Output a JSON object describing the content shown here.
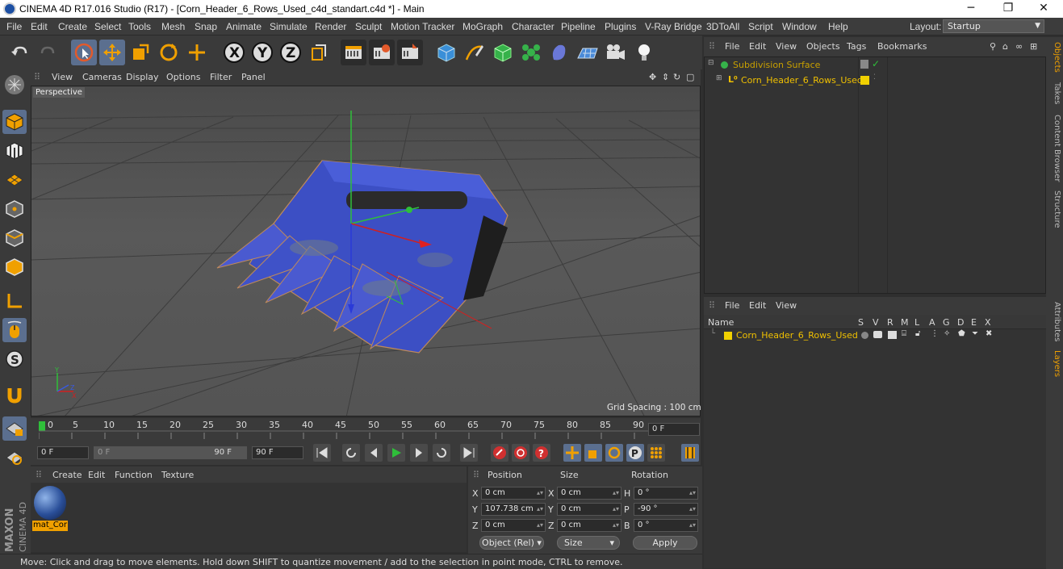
{
  "window": {
    "title": "CINEMA 4D R17.016 Studio (R17) - [Corn_Header_6_Rows_Used_c4d_standart.c4d *] - Main",
    "minimize": "─",
    "restore": "❐",
    "close": "✕"
  },
  "menubar": {
    "items": [
      "File",
      "Edit",
      "Create",
      "Select",
      "Tools",
      "Mesh",
      "Snap",
      "Animate",
      "Simulate",
      "Render",
      "Sculpt",
      "Motion Tracker",
      "MoGraph",
      "Character",
      "Pipeline",
      "Plugins",
      "V-Ray Bridge",
      "3DToAll",
      "Script",
      "Window",
      "Help"
    ],
    "layout_label": "Layout:",
    "layout_value": "Startup"
  },
  "viewport": {
    "menu": [
      "View",
      "Cameras",
      "Display",
      "Options",
      "Filter",
      "Panel"
    ],
    "camera_label": "Perspective",
    "grid_spacing": "Grid Spacing : 100 cm"
  },
  "timeline": {
    "ticks": [
      "0",
      "5",
      "10",
      "15",
      "20",
      "25",
      "30",
      "35",
      "40",
      "45",
      "50",
      "55",
      "60",
      "65",
      "70",
      "75",
      "80",
      "85",
      "90"
    ],
    "current_frame": "0 F",
    "start_field": "0 F",
    "range_start": "0 F",
    "range_end": "90 F",
    "end_field": "90 F"
  },
  "material_manager": {
    "menu": [
      "Create",
      "Edit",
      "Function",
      "Texture"
    ],
    "material_name": "mat_Cor"
  },
  "coordinates": {
    "headers": [
      "Position",
      "Size",
      "Rotation"
    ],
    "rows": [
      {
        "axis": "X",
        "pos": "0 cm",
        "size_axis": "X",
        "size": "0 cm",
        "rot_axis": "H",
        "rot": "0 °"
      },
      {
        "axis": "Y",
        "pos": "107.738 cm",
        "size_axis": "Y",
        "size": "0 cm",
        "rot_axis": "P",
        "rot": "-90 °"
      },
      {
        "axis": "Z",
        "pos": "0 cm",
        "size_axis": "Z",
        "size": "0 cm",
        "rot_axis": "B",
        "rot": "0 °"
      }
    ],
    "mode": "Object (Rel)",
    "size_mode": "Size",
    "apply": "Apply"
  },
  "statusbar": {
    "text": "Move: Click and drag to move elements. Hold down SHIFT to quantize movement / add to the selection in point mode, CTRL to remove."
  },
  "objects_manager": {
    "menu": [
      "File",
      "Edit",
      "View",
      "Objects",
      "Tags",
      "Bookmarks"
    ],
    "objects": [
      {
        "name": "Subdivision Surface",
        "color": "#c8a000"
      },
      {
        "name": "Corn_Header_6_Rows_Used",
        "color": "#f0c000"
      }
    ]
  },
  "layers_manager": {
    "menu": [
      "File",
      "Edit",
      "View"
    ],
    "columns": [
      "Name",
      "S",
      "V",
      "R",
      "M",
      "L",
      "A",
      "G",
      "D",
      "E",
      "X"
    ],
    "layers": [
      {
        "name": "Corn_Header_6_Rows_Used",
        "color": "#f0d000"
      }
    ]
  },
  "right_tabs": [
    "Objects",
    "Takes",
    "Content Browser",
    "Structure",
    "Attributes",
    "Layers"
  ],
  "brand": "MAXON CINEMA 4D",
  "colors": {
    "accent": "#f0a000",
    "selected": "#5b6f8f",
    "model_blue": "#3b4fc8"
  }
}
